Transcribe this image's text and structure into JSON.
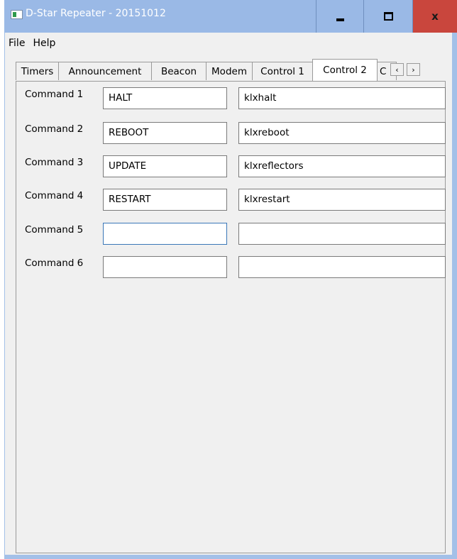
{
  "window": {
    "title": "D-Star Repeater - 20151012"
  },
  "controls": {
    "minimize": "minimize",
    "maximize": "maximize",
    "close": "x"
  },
  "menu": [
    "File",
    "Help"
  ],
  "tabs": [
    "Timers",
    "Announcement",
    "Beacon",
    "Modem",
    "Control 1",
    "Control 2",
    "C"
  ],
  "active_tab": "Control 2",
  "tab_scroll": {
    "left": "‹",
    "right": "›"
  },
  "commands": [
    {
      "label": "Command 1",
      "name": "HALT",
      "script": "klxhalt"
    },
    {
      "label": "Command 2",
      "name": "REBOOT",
      "script": "klxreboot"
    },
    {
      "label": "Command 3",
      "name": "UPDATE",
      "script": "klxreflectors"
    },
    {
      "label": "Command 4",
      "name": "RESTART",
      "script": "klxrestart"
    },
    {
      "label": "Command 5",
      "name": "",
      "script": ""
    },
    {
      "label": "Command 6",
      "name": "",
      "script": ""
    }
  ],
  "colors": {
    "titlebar": "#9ab9e6",
    "close_button": "#c9463d",
    "panel": "#f0f0f0"
  }
}
